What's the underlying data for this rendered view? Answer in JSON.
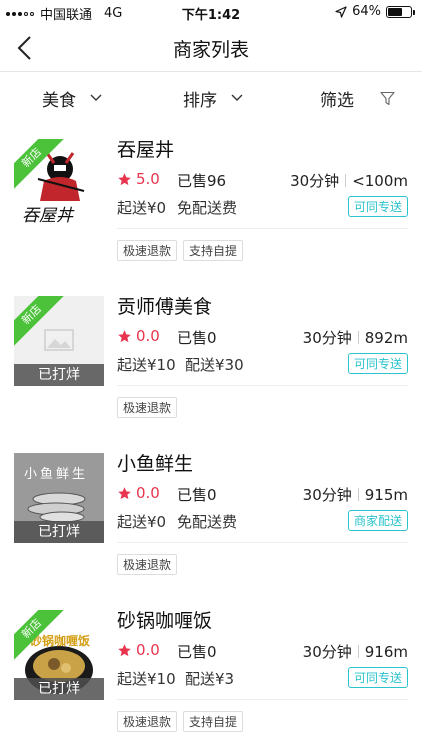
{
  "status_bar": {
    "carrier": "中国联通",
    "network": "4G",
    "time": "下午1:42",
    "battery": "64%",
    "battery_level": 0.64
  },
  "nav": {
    "title": "商家列表",
    "back_icon": "chevron-left-icon"
  },
  "filters": [
    {
      "label": "美食",
      "icon": "chevron-down-icon"
    },
    {
      "label": "排序",
      "icon": "chevron-down-icon"
    },
    {
      "label": "筛选",
      "icon": "funnel-icon"
    }
  ],
  "colors": {
    "accent_red": "#e8344e",
    "delivery_cyan": "#2bc3cd",
    "new_green": "#4cc23a"
  },
  "shops": [
    {
      "name": "吞屋丼",
      "rating": "5.0",
      "sold": "已售96",
      "time": "30分钟",
      "distance": "<100m",
      "min_order": "起送¥0",
      "delivery_fee": "免配送费",
      "delivery_type": "可同专送",
      "badge": "新店",
      "logo_text": "吞屋丼",
      "closed": "",
      "tags": [
        "极速退款",
        "支持自提"
      ]
    },
    {
      "name": "贡师傅美食",
      "rating": "0.0",
      "sold": "已售0",
      "time": "30分钟",
      "distance": "892m",
      "min_order": "起送¥10",
      "delivery_fee": "配送¥30",
      "delivery_type": "可同专送",
      "badge": "新店",
      "logo_text": "",
      "closed": "已打烊",
      "tags": [
        "极速退款"
      ]
    },
    {
      "name": "小鱼鲜生",
      "rating": "0.0",
      "sold": "已售0",
      "time": "30分钟",
      "distance": "915m",
      "min_order": "起送¥0",
      "delivery_fee": "免配送费",
      "delivery_type": "商家配送",
      "badge": "",
      "logo_text": "小鱼鲜生",
      "closed": "已打烊",
      "tags": [
        "极速退款"
      ]
    },
    {
      "name": "砂锅咖喱饭",
      "rating": "0.0",
      "sold": "已售0",
      "time": "30分钟",
      "distance": "916m",
      "min_order": "起送¥10",
      "delivery_fee": "配送¥3",
      "delivery_type": "可同专送",
      "badge": "新店",
      "logo_text": "砂锅咖喱饭",
      "closed": "已打烊",
      "tags": [
        "极速退款",
        "支持自提"
      ]
    }
  ]
}
